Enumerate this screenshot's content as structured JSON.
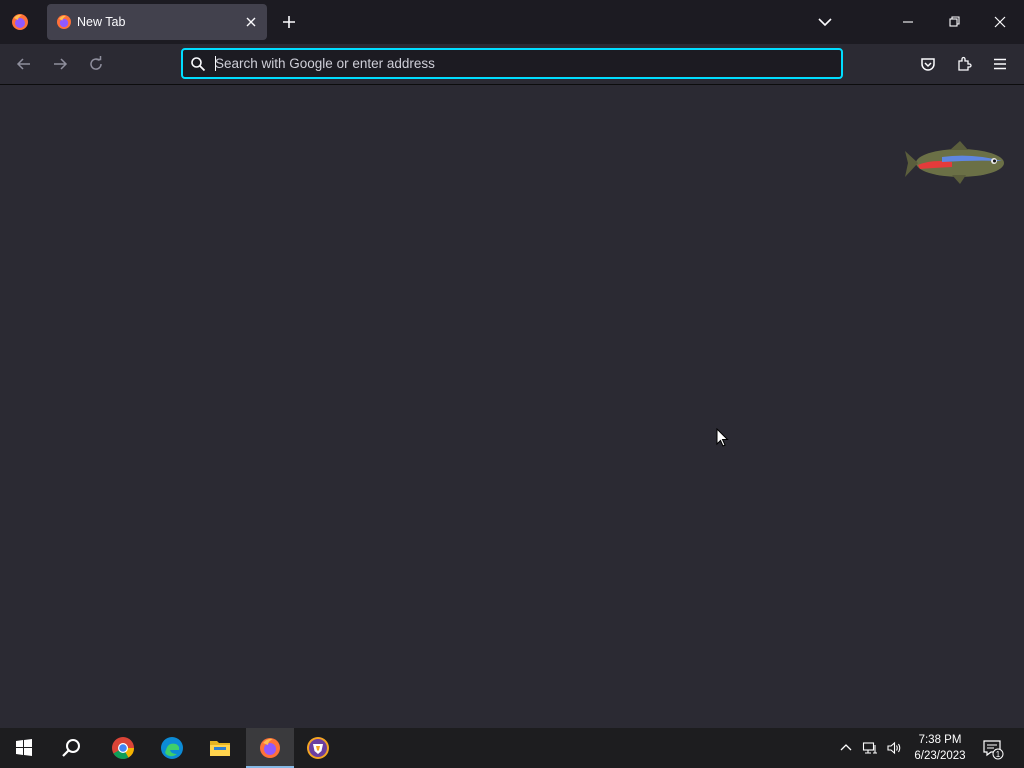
{
  "browser": {
    "tab": {
      "title": "New Tab"
    },
    "urlbar": {
      "placeholder": "Search with Google or enter address",
      "value": ""
    },
    "accent_color": "#00ddff"
  },
  "icons": {
    "tabstrip": [
      "firefox-view-icon",
      "tab-favicon",
      "close-tab-icon",
      "new-tab-icon",
      "list-all-tabs-icon",
      "minimize-icon",
      "restore-icon",
      "close-window-icon"
    ],
    "navbar": [
      "back-icon",
      "forward-icon",
      "reload-icon",
      "search-icon",
      "pocket-icon",
      "extensions-icon",
      "menu-icon"
    ],
    "taskbar": [
      "start-icon",
      "search-icon",
      "chrome-icon",
      "edge-icon",
      "file-explorer-icon",
      "firefox-icon",
      "brave-icon"
    ],
    "tray": [
      "chevron-up-icon",
      "network-icon",
      "volume-icon",
      "notification-icon"
    ]
  },
  "taskbar": {
    "clock": {
      "time": "7:38 PM",
      "date": "6/23/2023"
    },
    "notification_count": "1"
  }
}
